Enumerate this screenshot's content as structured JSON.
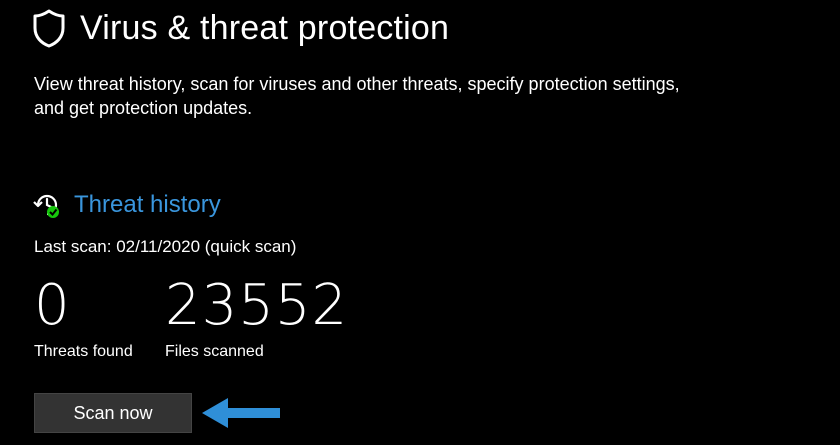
{
  "header": {
    "icon": "shield-icon",
    "title": "Virus & threat protection"
  },
  "description": "View threat history, scan for viruses and other threats, specify protection settings, and get protection updates.",
  "threat_history": {
    "icon": "history-check-icon",
    "title": "Threat history",
    "last_scan": "Last scan: 02/11/2020 (quick scan)",
    "threats_found": {
      "value": "0",
      "label": "Threats found"
    },
    "files_scanned": {
      "value": "23552",
      "label": "Files scanned"
    },
    "scan_button_label": "Scan now"
  },
  "annotation": {
    "icon": "arrow-left-icon"
  },
  "colors": {
    "background": "#000000",
    "text": "#ffffff",
    "link": "#3a96dd",
    "button": "#333333",
    "check": "#16c60c",
    "arrow": "#2f8fd8"
  }
}
